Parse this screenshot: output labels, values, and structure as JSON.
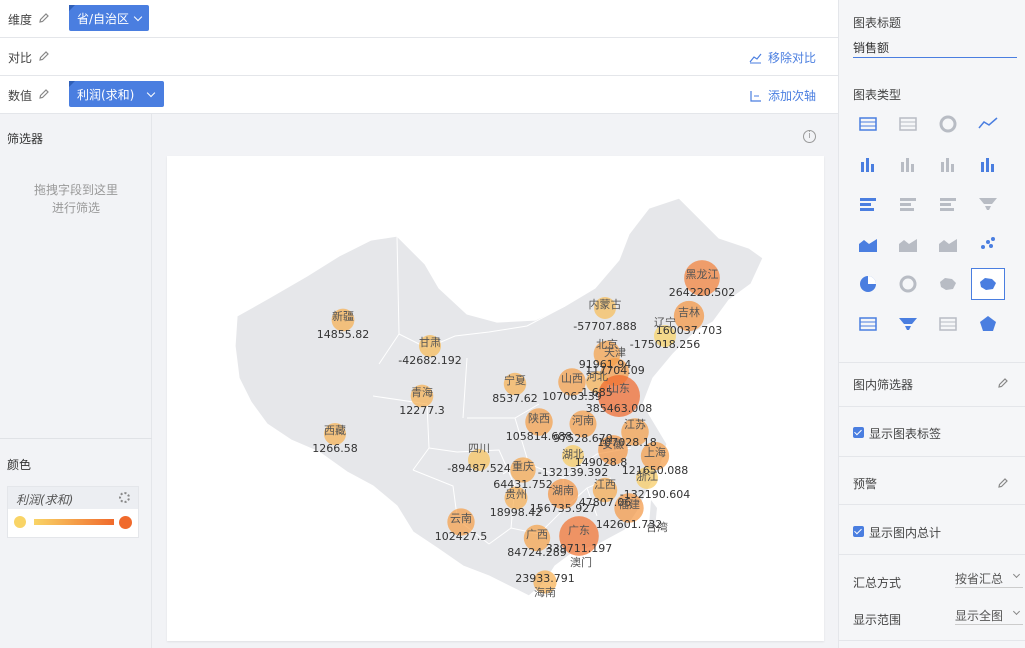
{
  "fields": {
    "dimension": {
      "label": "维度",
      "pill": "省/自治区"
    },
    "compare": {
      "label": "对比",
      "action": "移除对比"
    },
    "value": {
      "label": "数值",
      "pill": "利润(求和)",
      "action": "添加次轴"
    }
  },
  "filter": {
    "title": "筛选器",
    "hint_line1": "拖拽字段到这里",
    "hint_line2": "进行筛选"
  },
  "color": {
    "title": "颜色",
    "field": "利润(求和)",
    "low": "#f9d466",
    "high": "#f06a2c"
  },
  "right": {
    "title_label": "图表标题",
    "title_value": "销售额",
    "type_label": "图表类型",
    "inner_filter": "图内筛选器",
    "show_labels": "显示图表标签",
    "warning": "预警",
    "show_total": "显示图内总计",
    "agg_label": "汇总方式",
    "agg_value": "按省汇总",
    "range_label": "显示范围",
    "range_value": "显示全图"
  },
  "chart_icons": [
    "table-chart",
    "kpi-chart",
    "gauge-chart",
    "line-chart",
    "column-chart",
    "stacked-column-chart",
    "percent-column-chart",
    "grouped-column-chart",
    "bar-chart",
    "stacked-bar-chart",
    "percent-bar-chart",
    "funnel-compare-chart",
    "area-chart",
    "stacked-area-chart",
    "percent-area-chart",
    "scatter-chart",
    "pie-chart",
    "ring-chart",
    "flow-map-chart",
    "bubble-map-chart",
    "range-chart",
    "funnel-chart",
    "word-cloud-chart",
    "radar-chart"
  ],
  "chart_data": {
    "type": "bubble-map",
    "measure": "利润(求和)",
    "points": [
      {
        "name": "黑龙江",
        "value": 264220.502
      },
      {
        "name": "吉林",
        "value": 160037.703
      },
      {
        "name": "辽宁",
        "value": -175018.256
      },
      {
        "name": "内蒙古",
        "value": -57707.888
      },
      {
        "name": "新疆",
        "value": 14855.82
      },
      {
        "name": "甘肃",
        "value": -42682.192
      },
      {
        "name": "青海",
        "value": 12277.3
      },
      {
        "name": "西藏",
        "value": 1266.58
      },
      {
        "name": "宁夏",
        "value": 8537.62
      },
      {
        "name": "北京",
        "value": 91961.94
      },
      {
        "name": "天津",
        "value": 117704.09
      },
      {
        "name": "河北",
        "value": 1.685
      },
      {
        "name": "山西",
        "value": 107063.39
      },
      {
        "name": "山东",
        "value": 385463.008
      },
      {
        "name": "陕西",
        "value": 105814.688
      },
      {
        "name": "河南",
        "value": 97528.679
      },
      {
        "name": "江苏",
        "value": 107028.18
      },
      {
        "name": "安徽",
        "value": 149028.8
      },
      {
        "name": "上海",
        "value": 121650.088
      },
      {
        "name": "湖北",
        "value": -132139.392
      },
      {
        "name": "四川",
        "value": -89487.524
      },
      {
        "name": "重庆",
        "value": 64431.752
      },
      {
        "name": "浙江",
        "value": -132190.604
      },
      {
        "name": "贵州",
        "value": 18998.42
      },
      {
        "name": "湖南",
        "value": 156735.927
      },
      {
        "name": "江西",
        "value": 47807.06
      },
      {
        "name": "福建",
        "value": 142601.732
      },
      {
        "name": "云南",
        "value": 102427.5
      },
      {
        "name": "广西",
        "value": 84724.289
      },
      {
        "name": "广东",
        "value": 339711.197
      },
      {
        "name": "海南",
        "value": 23933.791
      }
    ],
    "extra_labels": [
      "台湾",
      "澳门"
    ]
  }
}
